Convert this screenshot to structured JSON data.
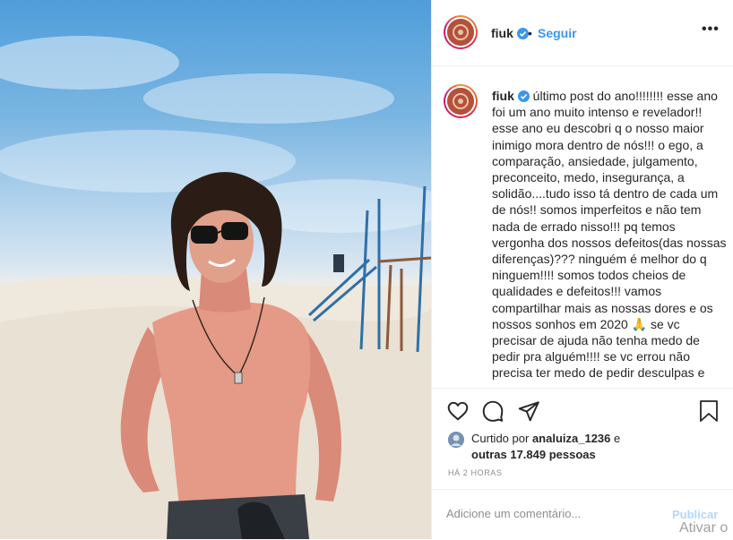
{
  "header": {
    "username": "fiuk",
    "separator": "•",
    "follow_label": "Seguir",
    "more_label": "•••"
  },
  "caption": {
    "username": "fiuk",
    "text": "último post do ano!!!!!!!! esse ano foi um ano muito intenso e revelador!! esse ano eu descobri q o nosso maior inimigo mora dentro de nós!!! o ego, a comparação, ansiedade, julgamento, preconceito, medo, insegurança, a solidão....tudo isso tá dentro de cada um de nós!! somos imperfeitos e não tem nada de errado nisso!!! pq temos vergonha dos nossos defeitos(das nossas diferenças)??? ninguém é melhor do q ninguem!!!! somos todos cheios de qualidades e defeitos!!! vamos compartilhar mais as nossas dores e os nossos sonhos em 2020 🙏 se vc precisar de ajuda não tenha medo de pedir pra alguém!!!! se vc errou não precisa ter medo de pedir desculpas e"
  },
  "likes": {
    "prefix": "Curtido por",
    "user": "analuiza_1236",
    "conjunction": "e",
    "others": "outras 17.849 pessoas"
  },
  "timestamp": "HÁ 2 HORAS",
  "comment": {
    "placeholder": "Adicione um comentário...",
    "post_label": "Publicar"
  },
  "system_watermark": "Ativar o",
  "colors": {
    "link": "#3897f0",
    "post_disabled": "#b3d7fb",
    "text": "#262626",
    "muted": "#8e8e8e"
  },
  "icons": [
    "verified-badge-icon",
    "heart-icon",
    "comment-icon",
    "share-icon",
    "bookmark-icon",
    "more-options-icon"
  ]
}
